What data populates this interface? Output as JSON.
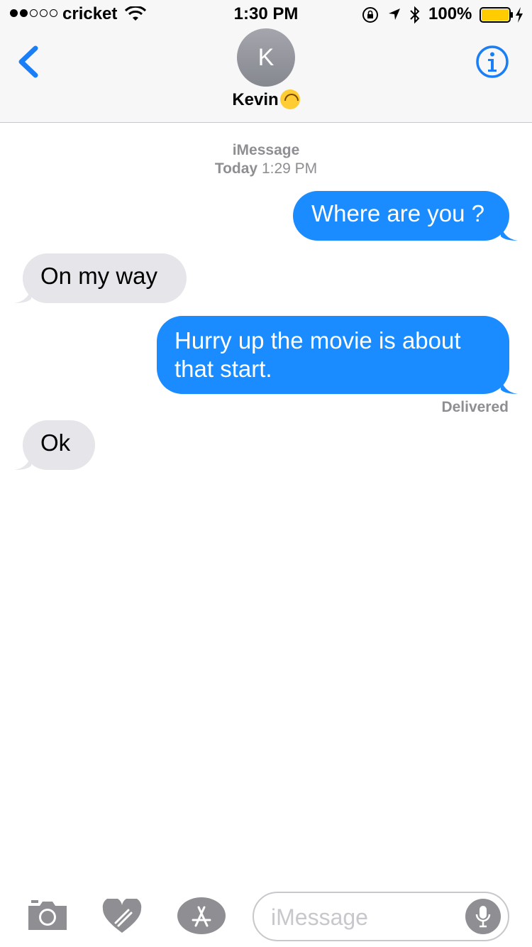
{
  "status": {
    "carrier": "cricket",
    "signal_bars_total": 5,
    "signal_bars_filled": 2,
    "time": "1:30 PM",
    "battery_percent": "100%",
    "battery_level": 1.0,
    "battery_color": "#ffcc00"
  },
  "header": {
    "avatar_initial": "K",
    "contact_name": "Kevin",
    "accent_color": "#1a7ff6",
    "back_icon": "chevron-left-icon",
    "info_icon": "info-icon"
  },
  "conversation": {
    "service": "iMessage",
    "timestamp_day": "Today",
    "timestamp_time": "1:29 PM",
    "messages": [
      {
        "direction": "outgoing",
        "text": "Where are you ?"
      },
      {
        "direction": "incoming",
        "text": "On my way"
      },
      {
        "direction": "outgoing",
        "text": "Hurry up the movie is about that start."
      },
      {
        "direction": "incoming",
        "text": "Ok"
      }
    ],
    "delivery_status": "Delivered",
    "outgoing_color": "#1a8cff",
    "incoming_color": "#e5e5ea"
  },
  "compose": {
    "placeholder": "iMessage",
    "value": "",
    "camera_icon": "camera-icon",
    "digital_touch_icon": "heart-icon",
    "apps_icon": "app-store-icon",
    "mic_icon": "microphone-icon"
  }
}
